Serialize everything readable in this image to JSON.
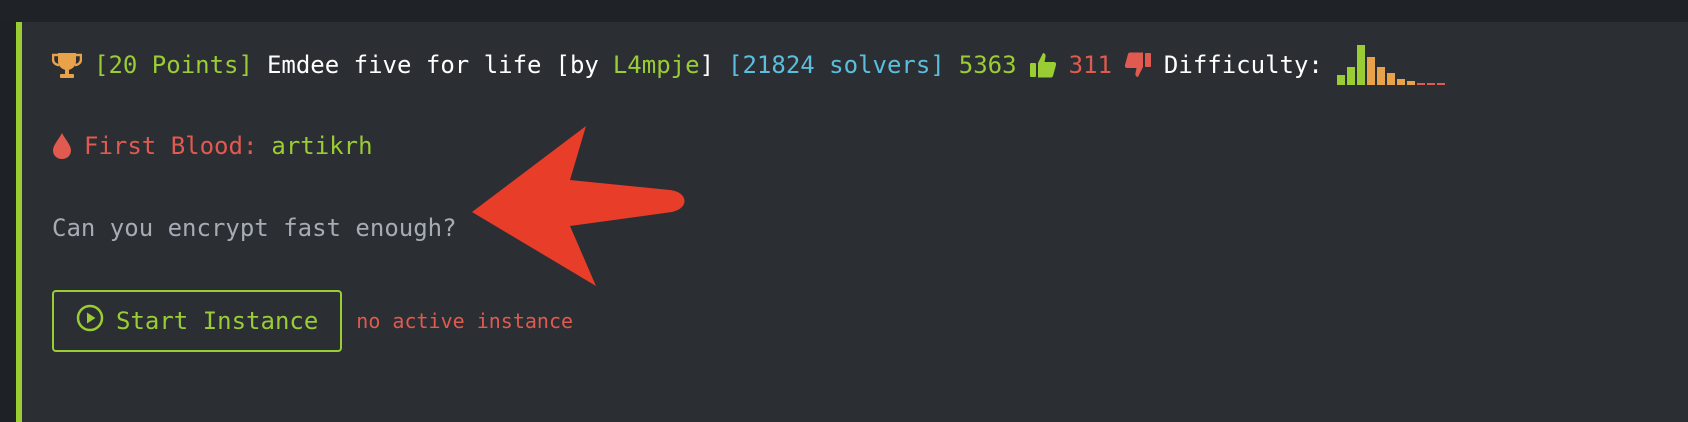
{
  "challenge": {
    "points_label": "[20 Points]",
    "name": "Emdee five for life",
    "by_prefix": "[by",
    "author": "L4mpje",
    "by_suffix": "]",
    "solvers_label": "[21824 solvers]",
    "upvotes": "5363",
    "downvotes": "311",
    "difficulty_label": "Difficulty:",
    "difficulty_distribution": [
      0.25,
      0.45,
      1.0,
      0.7,
      0.45,
      0.3,
      0.15,
      0.1,
      0.05,
      0.05,
      0.05
    ],
    "difficulty_colors": [
      "#9acc34",
      "#9acc34",
      "#9acc34",
      "#e7a24a",
      "#e7a24a",
      "#e7a24a",
      "#e7a24a",
      "#e7a24a",
      "#e05a4f",
      "#e05a4f",
      "#e05a4f"
    ]
  },
  "first_blood": {
    "label": "First Blood:",
    "user": "artikrh"
  },
  "description": "Can you encrypt fast enough?",
  "instance": {
    "button_label": "Start Instance",
    "status": "no active instance"
  },
  "icons": {
    "trophy": "trophy-icon",
    "thumbs_up": "thumbs-up-icon",
    "thumbs_down": "thumbs-down-icon",
    "blood_drop": "blood-drop-icon",
    "play": "play-circle-icon",
    "annotation": "red-arrow-annotation"
  },
  "colors": {
    "accent_green": "#9acc34",
    "solver_blue": "#5bbedc",
    "danger_red": "#e05a4f",
    "warning_orange": "#e7a24a",
    "arrow_red": "#e83d28",
    "panel_bg": "#2b2e33"
  }
}
